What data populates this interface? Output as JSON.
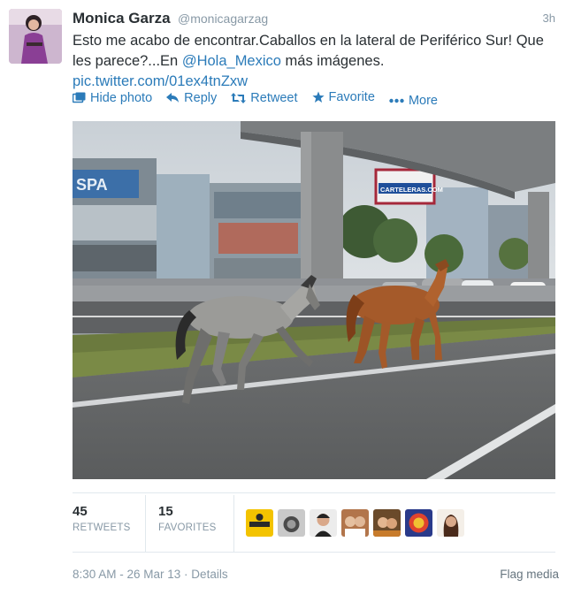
{
  "tweet": {
    "fullname": "Monica Garza",
    "username": "@monicagarzag",
    "time": "3h",
    "text_before": "Esto me acabo de encontrar.Caballos en la lateral de Periférico Sur! Que les parece?...En ",
    "mention": "@Hola_Mexico",
    "text_after": " más imágenes.",
    "pic_link": "pic.twitter.com/01ex4tnZxw"
  },
  "actions": {
    "hide_photo": "Hide photo",
    "reply": "Reply",
    "retweet": "Retweet",
    "favorite": "Favorite",
    "more": "More"
  },
  "photo": {
    "billboard_text": "CARTELERAS.COM",
    "building_sign": "SPA"
  },
  "stats": {
    "retweets_count": "45",
    "retweets_label": "RETWEETS",
    "favorites_count": "15",
    "favorites_label": "FAVORITES"
  },
  "footer": {
    "timestamp": "8:30 AM - 26 Mar 13 · Details",
    "flag_media": "Flag media"
  },
  "colors": {
    "link": "#2b7bb9",
    "muted": "#8899a6",
    "text": "#292f33"
  }
}
